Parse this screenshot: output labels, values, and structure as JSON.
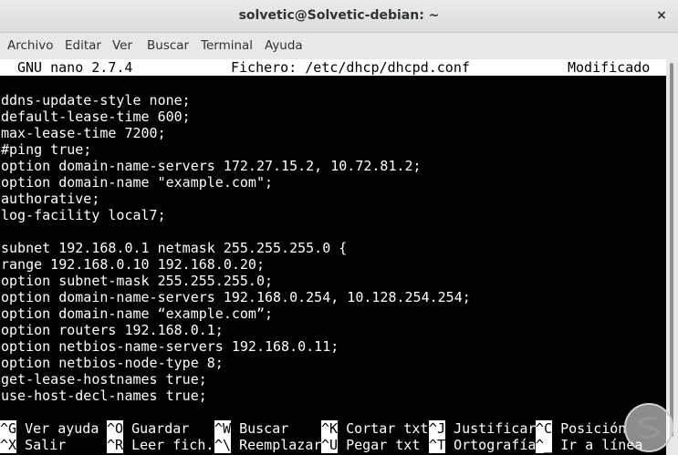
{
  "window": {
    "title": "solvetic@Solvetic-debian: ~",
    "close_icon": "×"
  },
  "menu": {
    "items": [
      "Archivo",
      "Editar",
      "Ver",
      "Buscar",
      "Terminal",
      "Ayuda"
    ]
  },
  "nano": {
    "version": "GNU nano 2.7.4",
    "file": "Fichero: /etc/dhcp/dhcpd.conf",
    "status": "Modificado"
  },
  "file_lines": [
    "",
    "ddns-update-style none;",
    "default-lease-time 600;",
    "max-lease-time 7200;",
    "#ping true;",
    "option domain-name-servers 172.27.15.2, 10.72.81.2;",
    "option domain-name \"example.com\";",
    "authorative;",
    "log-facility local7;",
    "",
    "subnet 192.168.0.1 netmask 255.255.255.0 {",
    "range 192.168.0.10 192.168.0.20;",
    "option subnet-mask 255.255.255.0;",
    "option domain-name-servers 192.168.0.254, 10.128.254.254;",
    "option domain-name “example.com”;",
    "option routers 192.168.0.1;",
    "option netbios-name-servers 192.168.0.11;",
    "option netbios-node-type 8;",
    "get-lease-hostnames true;",
    "use-host-decl-names true;"
  ],
  "shortcuts": {
    "row1": [
      {
        "key": "^G",
        "label": " Ver ayuda"
      },
      {
        "key": "^O",
        "label": " Guardar"
      },
      {
        "key": "^W",
        "label": " Buscar"
      },
      {
        "key": "^K",
        "label": " Cortar txt"
      },
      {
        "key": "^J",
        "label": " Justificar"
      },
      {
        "key": "^C",
        "label": " Posición"
      }
    ],
    "row2": [
      {
        "key": "^X",
        "label": " Salir"
      },
      {
        "key": "^R",
        "label": " Leer fich."
      },
      {
        "key": "^\\",
        "label": " Reemplazar"
      },
      {
        "key": "^U",
        "label": " Pegar txt"
      },
      {
        "key": "^T",
        "label": " Ortografía"
      },
      {
        "key": "^_",
        "label": " Ir a línea"
      }
    ]
  },
  "colors": {
    "terminal_bg": "#000000",
    "terminal_fg": "#ffffff",
    "chrome_bg": "#e8e8e7"
  },
  "icons": {
    "watermark": "solvetic-logo-icon"
  }
}
